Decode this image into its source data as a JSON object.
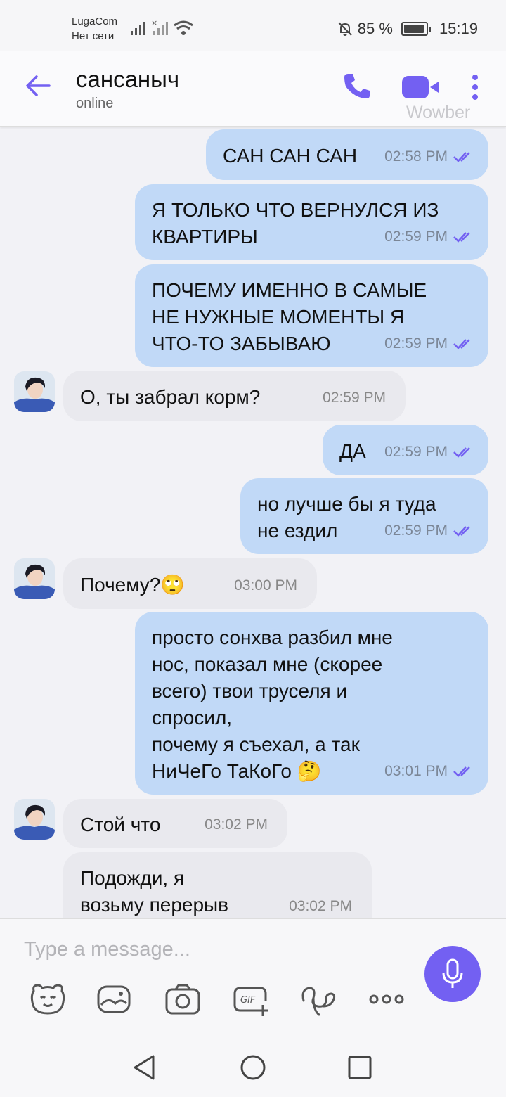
{
  "status_bar": {
    "carrier": "LugaCom",
    "network": "Нет сети",
    "battery": "85 %",
    "battery_level": 0.85,
    "time": "15:19"
  },
  "header": {
    "contact_name": "сансаныч",
    "status": "online",
    "watermark": "Wowber"
  },
  "messages": [
    {
      "dir": "out",
      "text": "САН САН САН",
      "time": "02:58 PM"
    },
    {
      "dir": "out",
      "text": "Я ТОЛЬКО ЧТО ВЕРНУЛСЯ ИЗ\nКВАРТИРЫ",
      "time": "02:59 PM"
    },
    {
      "dir": "out",
      "text": "ПОЧЕМУ ИМЕННО В САМЫЕ\nНЕ НУЖНЫЕ МОМЕНТЫ Я\nЧТО-ТО ЗАБЫВАЮ",
      "time": "02:59 PM"
    },
    {
      "dir": "in",
      "text": "О, ты забрал корм?",
      "time": "02:59 PM"
    },
    {
      "dir": "out",
      "text": "ДА",
      "time": "02:59 PM"
    },
    {
      "dir": "out",
      "text": "но лучше бы я туда\nне ездил",
      "time": "02:59 PM"
    },
    {
      "dir": "in",
      "text": "Почему?🙄",
      "time": "03:00 PM"
    },
    {
      "dir": "out",
      "text": "просто сонхва разбил мне\nнос, показал мне (скорее\nвсего) твои труселя и\nспросил,\nпочему я съехал, а так\nНиЧеГо ТаКоГо 🤔",
      "time": "03:01 PM"
    },
    {
      "dir": "in",
      "text": "Стой что",
      "time": "03:02 PM"
    },
    {
      "dir": "in",
      "text": "Подожди, я\nвозьму перерыв",
      "time": "03:02 PM"
    }
  ],
  "composer": {
    "placeholder": "Type a message..."
  },
  "colors": {
    "accent": "#7360f2",
    "outgoing_bubble": "#c1d9f7",
    "incoming_bubble": "#e9e9ee"
  }
}
